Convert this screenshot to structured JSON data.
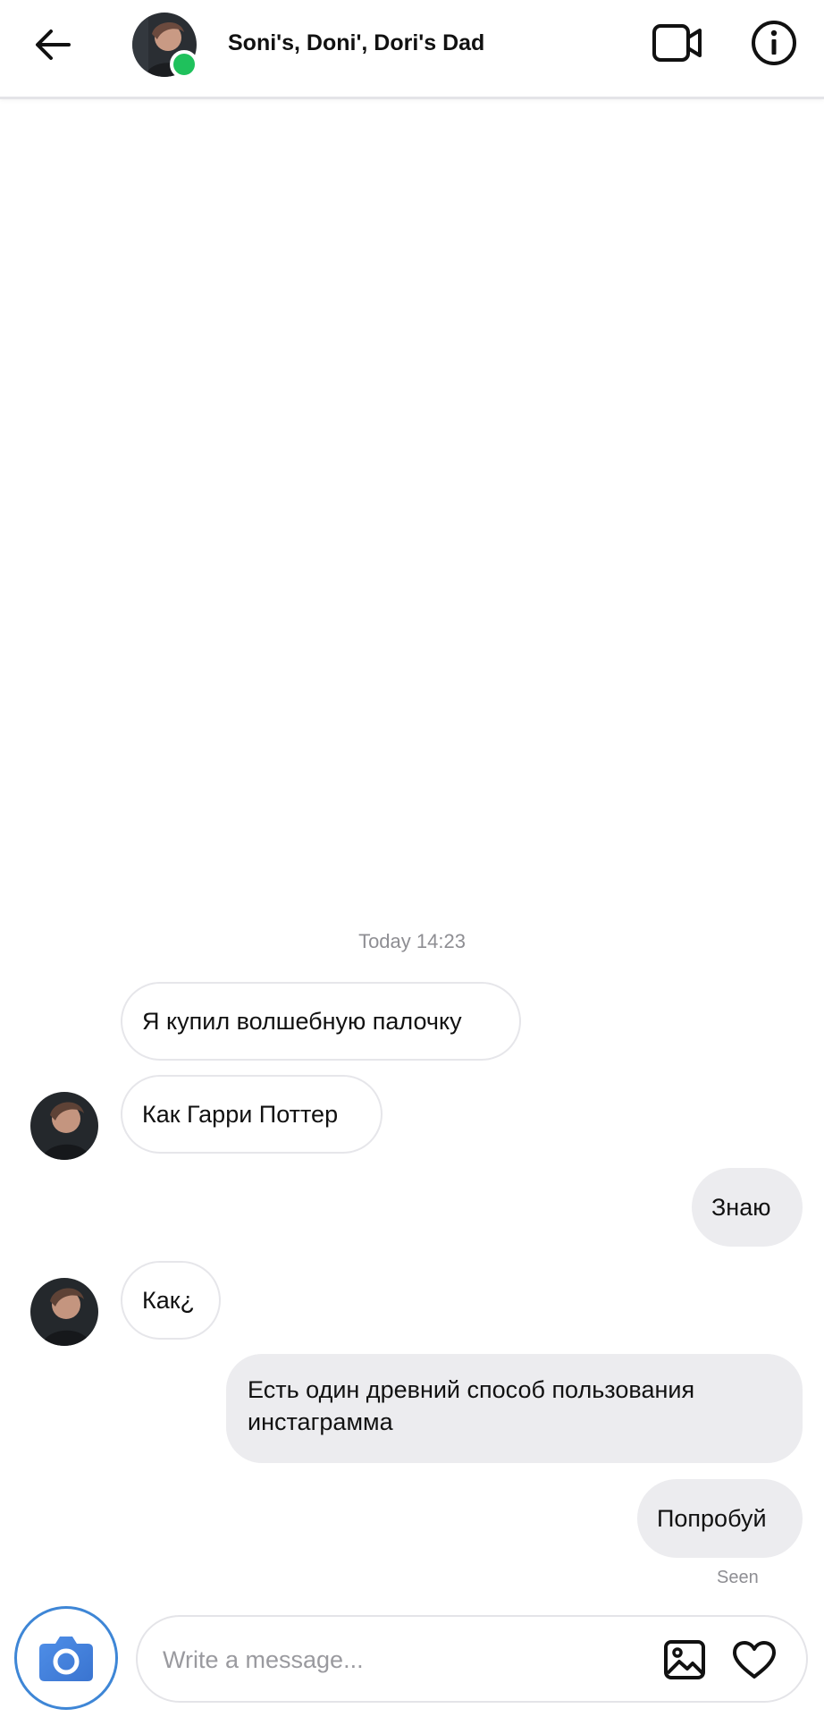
{
  "header": {
    "title": "Soni's, Doni', Dori's Dad",
    "online": true,
    "online_color": "#1fc15c",
    "icons": {
      "back": "arrow-left-icon",
      "video": "video-camera-icon",
      "info": "info-icon"
    }
  },
  "thread": {
    "timestamp": "Today 14:23",
    "messages": [
      {
        "direction": "incoming",
        "text": "Я купил волшебную палочку",
        "show_avatar": false
      },
      {
        "direction": "incoming",
        "text": "Как Гарри Поттер",
        "show_avatar": true
      },
      {
        "direction": "outgoing",
        "text": "Знаю"
      },
      {
        "direction": "incoming",
        "text": "Как¿",
        "show_avatar": true
      },
      {
        "direction": "outgoing",
        "text_lines": [
          "Есть один древний способ пользования",
          "инстаграмма"
        ]
      },
      {
        "direction": "outgoing",
        "text": "Попробуй"
      }
    ],
    "seen_label": "Seen"
  },
  "composer": {
    "placeholder": "Write a message...",
    "value": "",
    "camera_color": "#3e86d6",
    "icons": {
      "camera": "camera-icon",
      "gallery": "image-icon",
      "like": "heart-icon"
    }
  }
}
